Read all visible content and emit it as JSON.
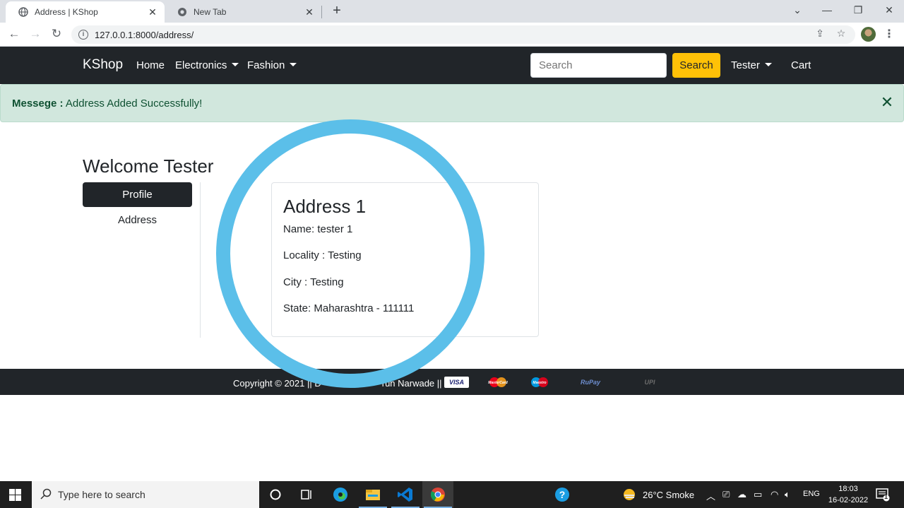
{
  "browser": {
    "tabs": [
      {
        "title": "Address | KShop",
        "active": true
      },
      {
        "title": "New Tab",
        "active": false
      }
    ],
    "url": "127.0.0.1:8000/address/"
  },
  "navbar": {
    "brand": "KShop",
    "links": [
      "Home",
      "Electronics",
      "Fashion"
    ],
    "search_placeholder": "Search",
    "search_button": "Search",
    "user_menu": "Tester",
    "cart": "Cart"
  },
  "alert": {
    "label": "Messege :",
    "message": "Address Added Successfully!",
    "close_icon": "close-icon"
  },
  "page": {
    "welcome": "Welcome Tester",
    "sidebar": {
      "profile": "Profile",
      "address": "Address"
    },
    "address_card": {
      "title": "Address 1",
      "name": "Name: tester 1",
      "locality": "Locality : Testing",
      "city": "City : Testing",
      "state": "State: Maharashtra - 111111"
    },
    "highlight_color": "#5bbfe9"
  },
  "footer": {
    "copyright": "Copyright © 2021 || D",
    "copyright_end": "run Narwade ||",
    "payments": [
      "VISA",
      "MasterCard",
      "Maestro",
      "RuPay",
      "UPI"
    ]
  },
  "taskbar": {
    "search_placeholder": "Type here to search",
    "weather": "26°C  Smoke",
    "language": "ENG",
    "time": "18:03",
    "date": "16-02-2022",
    "notification_count": "1"
  },
  "colors": {
    "navbar_bg": "#212529",
    "accent_button": "#ffc107",
    "alert_bg": "#d1e7dd",
    "alert_text": "#0f5132"
  }
}
